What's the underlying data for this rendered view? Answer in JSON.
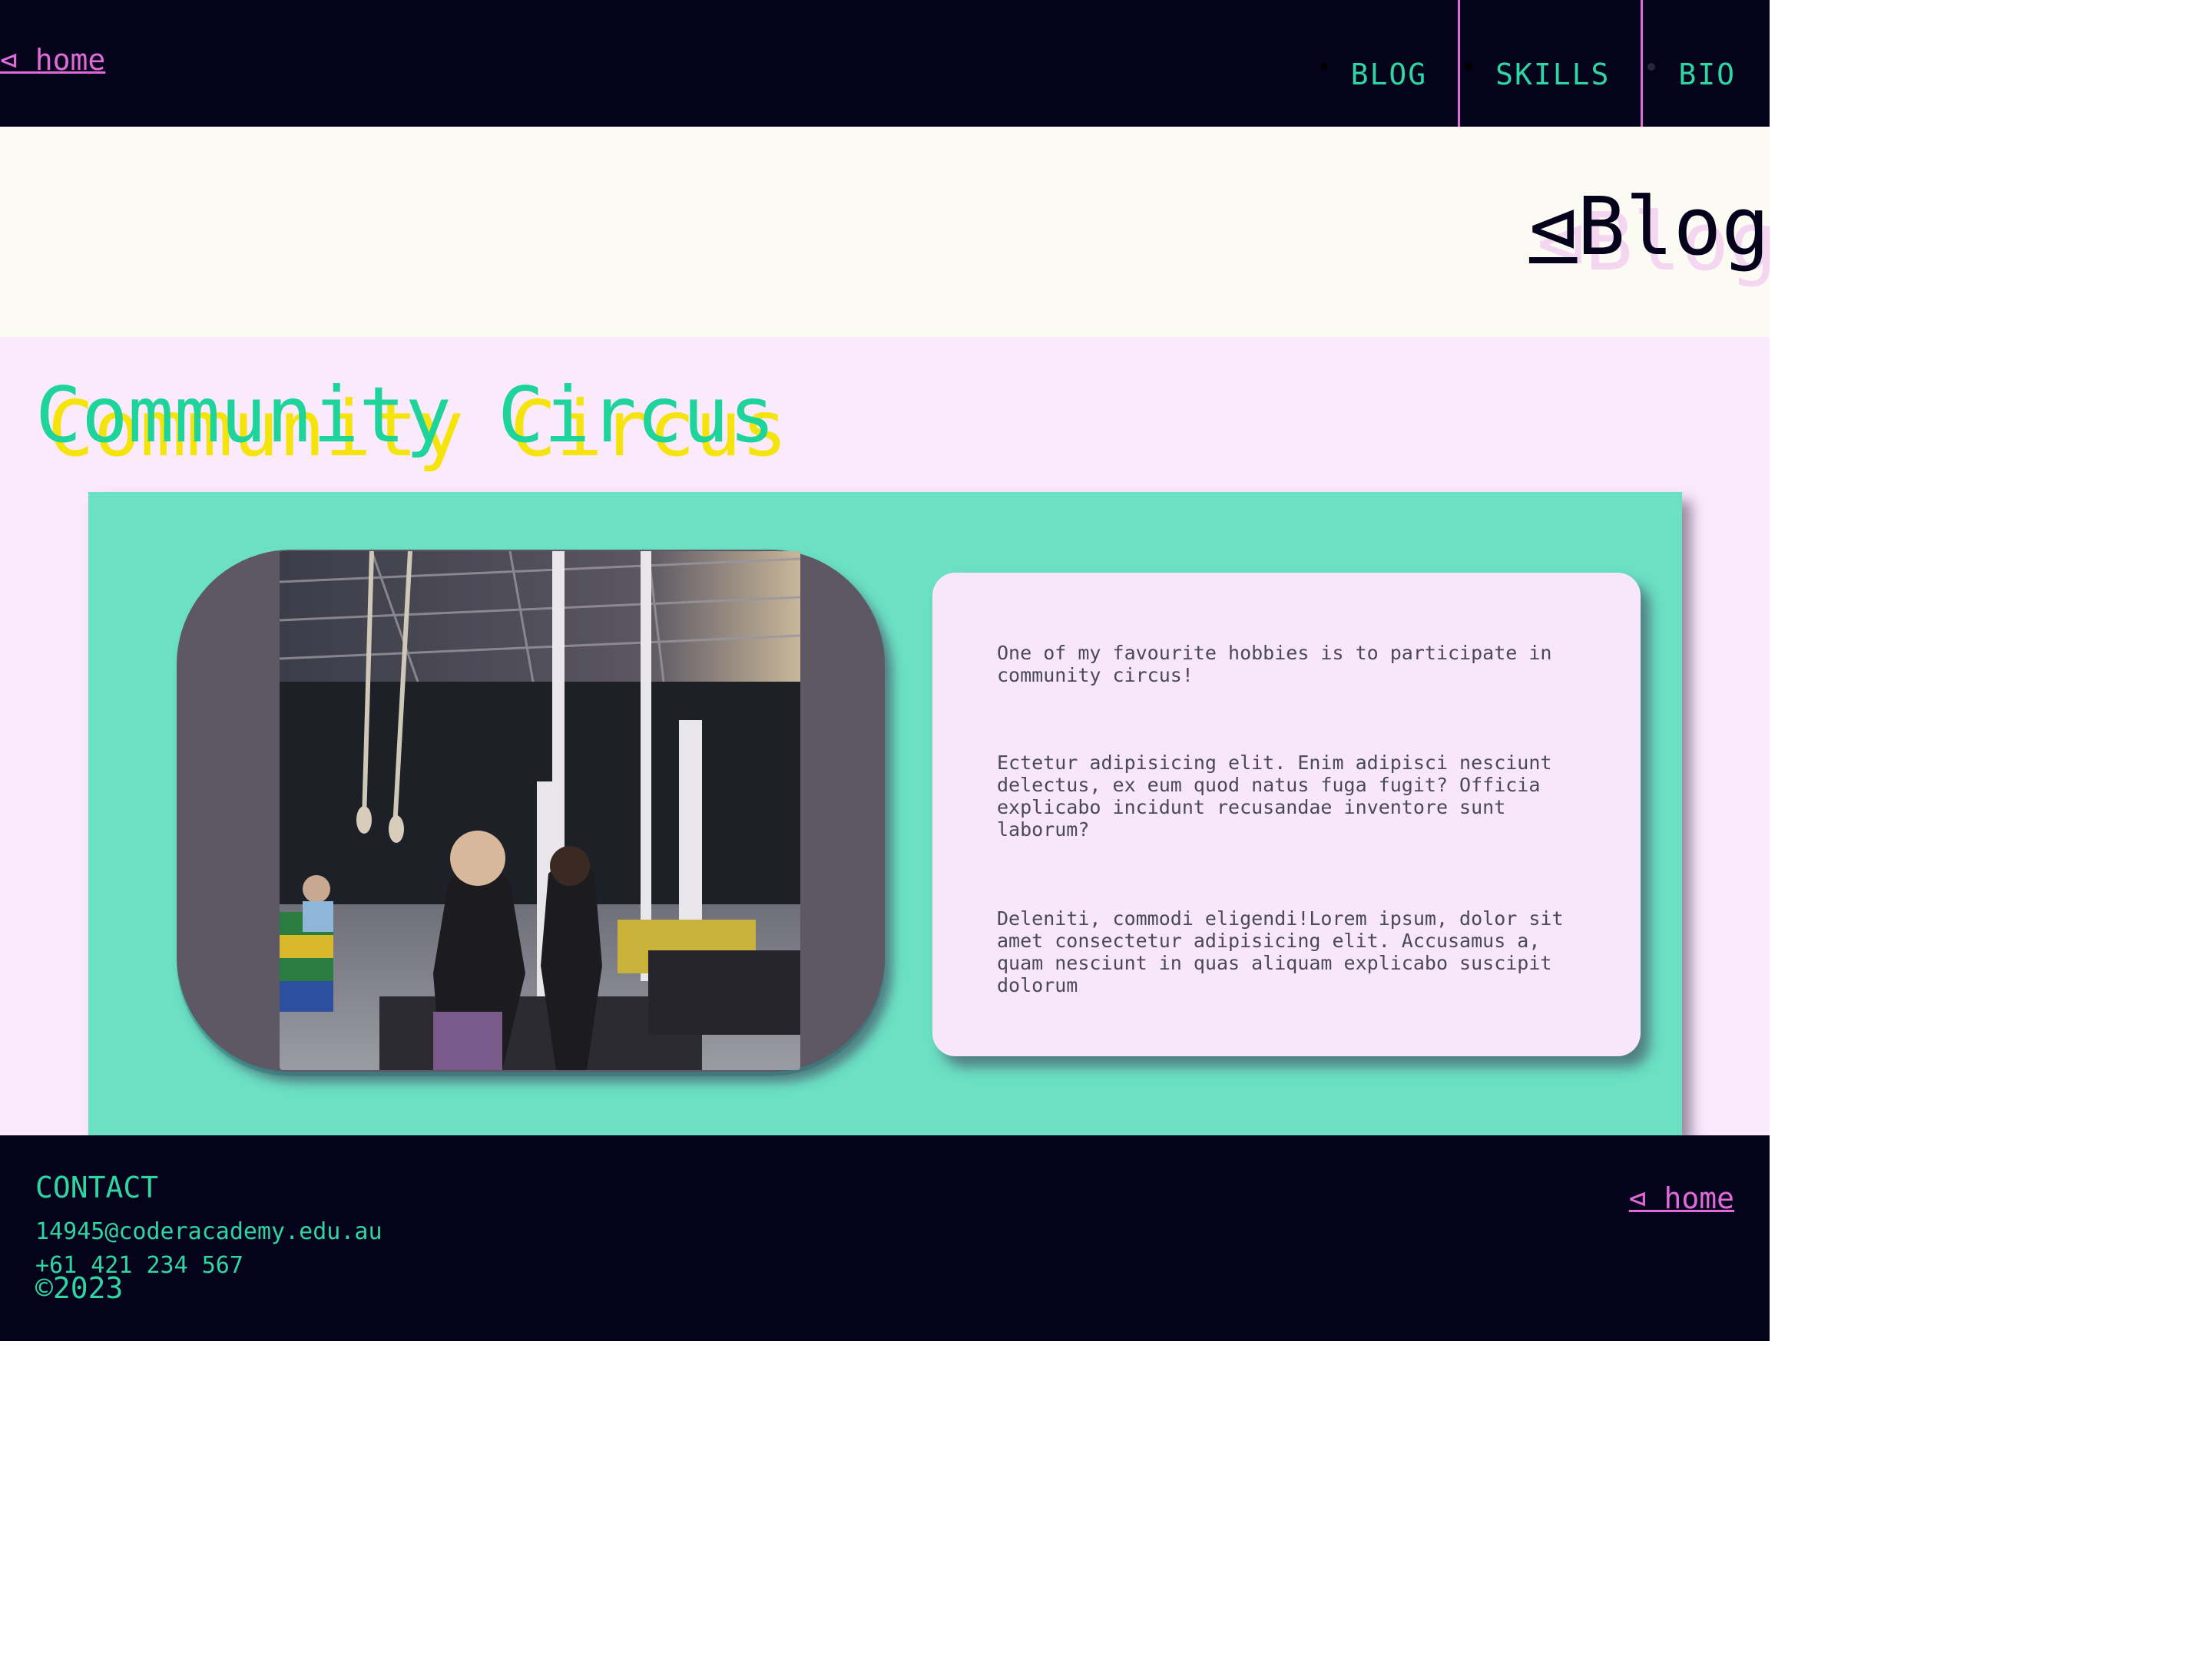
{
  "header": {
    "home_link": "⊲ home",
    "nav": [
      {
        "label": "BLOG"
      },
      {
        "label": "SKILLS"
      },
      {
        "label": "BIO"
      }
    ]
  },
  "page": {
    "title_symbol": "⊲",
    "title": "Blog"
  },
  "post": {
    "title": "Community Circus",
    "paragraphs": [
      "One of my favourite hobbies is to participate in community circus!",
      "Ectetur adipisicing elit. Enim adipisci nesciunt delectus, ex eum quod natus fuga fugit? Officia explicabo incidunt recusandae inventore sunt laborum?",
      "Deleniti, commodi eligendi!Lorem ipsum, dolor sit amet consectetur adipisicing elit. Accusamus a, quam nesciunt in quas aliquam explicabo suscipit dolorum"
    ]
  },
  "footer": {
    "contact_heading": "CONTACT",
    "email": "14945@coderacademy.edu.au",
    "phone": "+61 421 234 567",
    "copyright": "©2023",
    "home_link": "⊲ home"
  },
  "colors": {
    "dark": "#05031b",
    "teal": "#2fd6a3",
    "pink": "#e06ad8",
    "yellow": "#f4e40b",
    "card_teal": "#6be0c3"
  }
}
